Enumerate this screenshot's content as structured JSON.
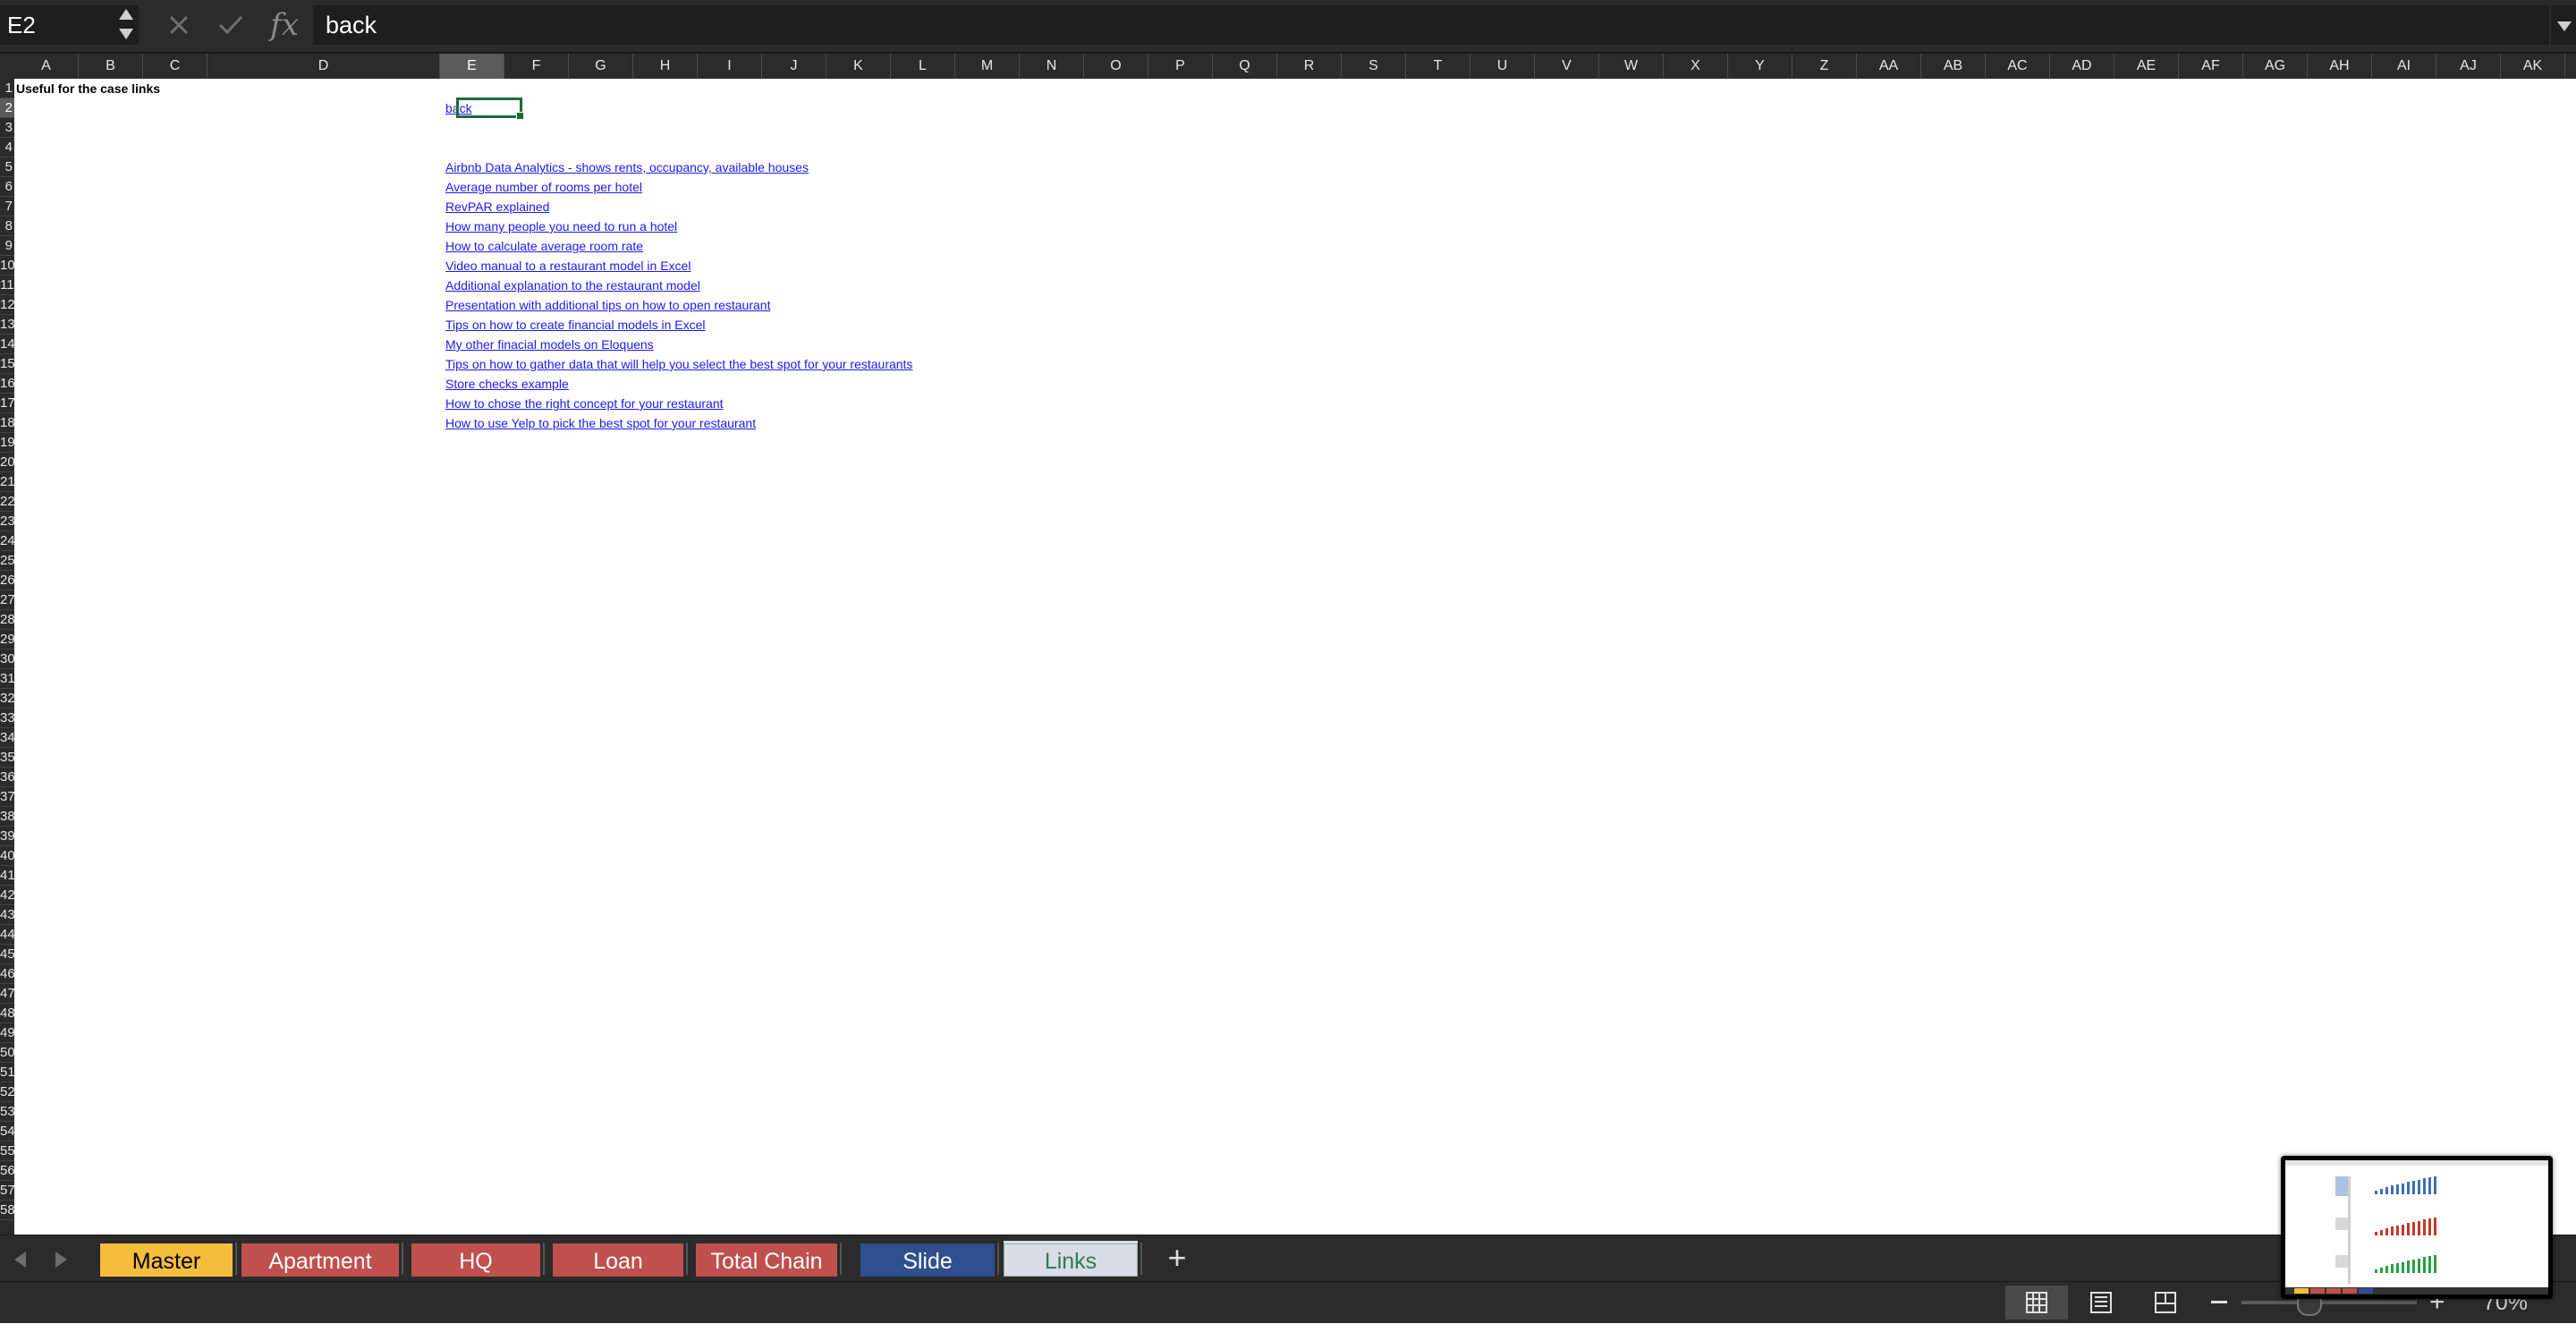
{
  "formula_bar": {
    "name_box": "E2",
    "cancel_icon": "close-icon",
    "confirm_icon": "check-icon",
    "fx_label": "fx",
    "formula_value": "back"
  },
  "columns": [
    "A",
    "B",
    "C",
    "D",
    "E",
    "F",
    "G",
    "H",
    "I",
    "J",
    "K",
    "L",
    "M",
    "N",
    "O",
    "P",
    "Q",
    "R",
    "S",
    "T",
    "U",
    "V",
    "W",
    "X",
    "Y",
    "Z",
    "AA",
    "AB",
    "AC",
    "AD",
    "AE",
    "AF",
    "AG",
    "AH",
    "AI",
    "AJ",
    "AK"
  ],
  "selected_column": "E",
  "selected_row": "2",
  "rows": [
    "1",
    "2",
    "3",
    "4",
    "5",
    "6",
    "7",
    "8",
    "9",
    "10",
    "11",
    "12",
    "13",
    "14",
    "15",
    "16",
    "17",
    "18",
    "19",
    "20",
    "21",
    "22",
    "23",
    "24",
    "25",
    "26",
    "27",
    "28",
    "29",
    "30",
    "31",
    "32",
    "33",
    "34",
    "35",
    "36",
    "37",
    "38",
    "39",
    "40",
    "41",
    "42",
    "43",
    "44",
    "45",
    "46",
    "47",
    "48",
    "49",
    "50",
    "51",
    "52",
    "53",
    "54",
    "55",
    "56",
    "57",
    "58"
  ],
  "sheet": {
    "a1_text": "Useful for the case links",
    "back_link": "back",
    "links": [
      "Airbnb Data Analytics - shows rents, occupancy, available houses",
      "Average number of rooms per hotel",
      "RevPAR explained",
      "How many people you need to run a hotel",
      "How to calculate average room rate",
      "Video manual to a restaurant model in Excel",
      "Additional explanation to the restaurant model",
      "Presentation with additional tips on how to open restaurant",
      "Tips on how to create financial models in Excel",
      "My other finacial models on Eloquens",
      "Tips on how to gather data that will help you select the best spot for your restaurants",
      "Store checks example",
      "How to chose the right concept for your restaurant",
      "How to use Yelp to pick the best spot for your restaurant"
    ]
  },
  "tabs": [
    {
      "label": "Master",
      "color": "#f4bd3c",
      "text_color": "#000000"
    },
    {
      "label": "Apartment",
      "color": "#c0504d",
      "text_color": "#ffffff"
    },
    {
      "label": "HQ",
      "color": "#c0504d",
      "text_color": "#ffffff"
    },
    {
      "label": "Loan",
      "color": "#c0504d",
      "text_color": "#ffffff"
    },
    {
      "label": "Total Chain",
      "color": "#c0504d",
      "text_color": "#ffffff"
    },
    {
      "label": "Slide",
      "color": "#2f4f8f",
      "text_color": "#ffffff"
    },
    {
      "label": "Links",
      "color": "#d8dde6",
      "text_color": "#2e7d4f",
      "active": true
    }
  ],
  "status_bar": {
    "zoom_label": "70%",
    "view_icons": [
      "normal-view-icon",
      "page-layout-view-icon",
      "page-break-view-icon"
    ]
  },
  "colors": {
    "chrome": "#2b2b2b",
    "selection": "#1e6b3a",
    "link": "#1a1aee"
  }
}
